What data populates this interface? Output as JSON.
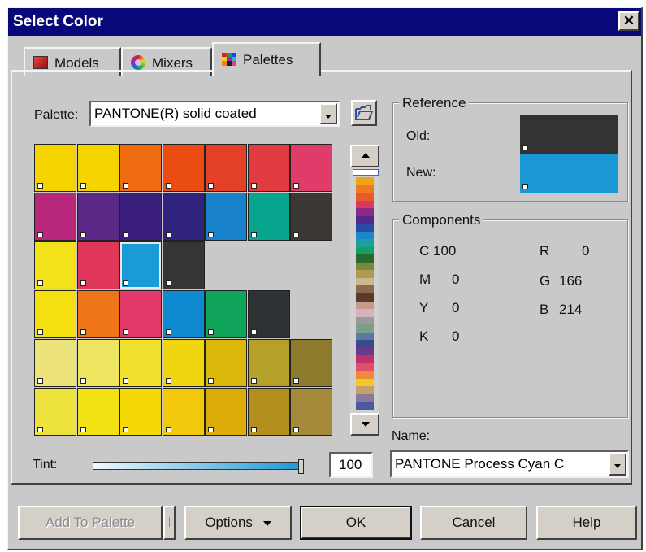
{
  "window": {
    "title": "Select Color"
  },
  "tabs": [
    {
      "label": "Models",
      "icon": "models-icon",
      "active": false
    },
    {
      "label": "Mixers",
      "icon": "mixers-icon",
      "active": false
    },
    {
      "label": "Palettes",
      "icon": "palettes-icon",
      "active": true
    }
  ],
  "palette": {
    "label": "Palette:",
    "value": "PANTONE(R) solid coated"
  },
  "swatches": [
    [
      "#f6d400",
      "#f6d400",
      "#ef6b10",
      "#ea4c12",
      "#e54129",
      "#e13a40",
      "#e03c6a"
    ],
    [
      "#b7287a",
      "#5a2a86",
      "#3a1f7c",
      "#30237e",
      "#1881cb",
      "#07a58d",
      "#3a3735"
    ],
    [
      "#f3e21a",
      "#e0365a",
      "#1a9ad6",
      "#353535"
    ],
    [
      "#f4df10",
      "#ee7618",
      "#e23a6a",
      "#0d8ad0",
      "#10a45a",
      "#2f3234"
    ],
    [
      "#ece47a",
      "#eee560",
      "#f1e12c",
      "#f0d60e",
      "#d9b80a",
      "#b5a02a",
      "#8d7a2c"
    ],
    [
      "#eee23c",
      "#f2e213",
      "#f4d808",
      "#f2c90a",
      "#ddac08",
      "#b38f1e",
      "#a48a3a"
    ]
  ],
  "selected_swatch": {
    "row": 2,
    "col": 2
  },
  "reference": {
    "title": "Reference",
    "old_label": "Old:",
    "new_label": "New:",
    "old_color": "#333333",
    "new_color": "#1a98d6"
  },
  "components": {
    "title": "Components",
    "c": "C 100",
    "m": "M",
    "m_val": "0",
    "y": "Y",
    "y_val": "0",
    "k": "K",
    "k_val": "0",
    "r": "R",
    "r_val": "0",
    "g": "G",
    "g_val": "166",
    "b": "B",
    "b_val": "214"
  },
  "name": {
    "label": "Name:",
    "value": "PANTONE Process Cyan C"
  },
  "tint": {
    "label": "Tint:",
    "value": "100",
    "fraction": 1.0
  },
  "buttons": {
    "add_to_palette": "Add To Palette",
    "options": "Options",
    "ok": "OK",
    "cancel": "Cancel",
    "help": "Help"
  },
  "scrollbar_stripes": [
    "#f2a31c",
    "#ec7b22",
    "#e85a2a",
    "#d63a62",
    "#8a2a80",
    "#502a8a",
    "#2a4ca0",
    "#1a88c8",
    "#1aa0a0",
    "#14a060",
    "#2a6a30",
    "#7a8a3a",
    "#b09a50",
    "#c8b890",
    "#8a6a4a",
    "#5a3a2a",
    "#c89a8a",
    "#d8b0c0",
    "#9a9a9a",
    "#7aa08a",
    "#5a7aa0",
    "#3a4a8a",
    "#6a3a8a",
    "#c0306a",
    "#e0506a",
    "#f08a3a",
    "#f2c82a",
    "#c8a070",
    "#8a7a9a",
    "#4a5aa0"
  ],
  "colors": {
    "titlebar": "#08087a",
    "face": "#c9c9c9"
  }
}
